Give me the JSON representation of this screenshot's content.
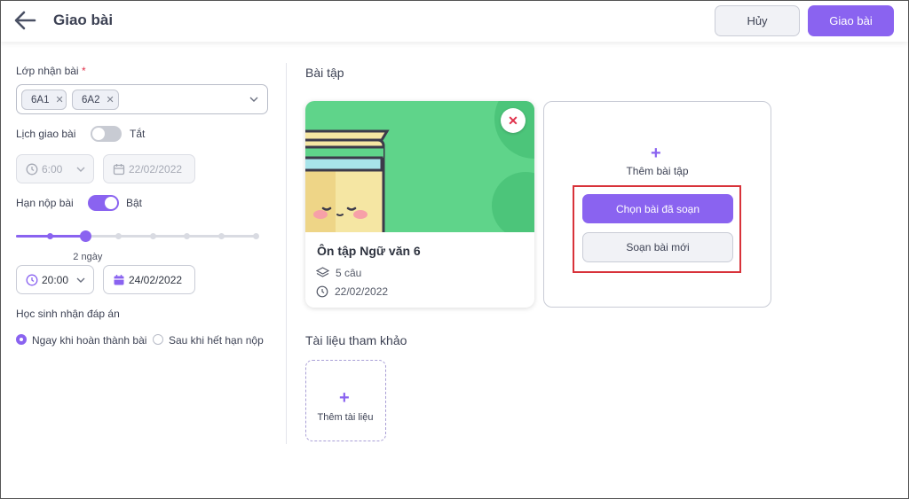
{
  "header": {
    "title": "Giao bài",
    "cancel_label": "Hủy",
    "assign_label": "Giao bài"
  },
  "left": {
    "class_label": "Lớp nhận bài",
    "required_mark": "*",
    "classes": [
      "6A1",
      "6A2"
    ],
    "schedule_label": "Lịch giao bài",
    "schedule_toggle_state": "Tắt",
    "schedule_time": "6:00",
    "schedule_date": "22/02/2022",
    "deadline_label": "Hạn nộp bài",
    "deadline_toggle_state": "Bật",
    "slider_value_label": "2 ngày",
    "slider_fraction": 0.29,
    "deadline_time": "20:00",
    "deadline_date": "24/02/2022",
    "answer_label": "Học sinh nhận đáp án",
    "answer_options": [
      "Ngay khi hoàn thành bài",
      "Sau khi hết hạn nộp"
    ],
    "answer_selected": 0
  },
  "right": {
    "exercises_title": "Bài tập",
    "exercise_card": {
      "title": "Ôn tập Ngữ văn 6",
      "questions": "5 câu",
      "date": "22/02/2022",
      "remove_icon": "close-icon"
    },
    "add_exercise_label": "Thêm bài tập",
    "choose_label": "Chọn bài đã soạn",
    "new_label": "Soạn bài mới",
    "references_title": "Tài liệu tham khảo",
    "add_document_label": "Thêm tài liệu"
  },
  "colors": {
    "accent": "#8a63f0",
    "cover_green": "#5fd48a",
    "highlight_red": "#d8323a"
  }
}
